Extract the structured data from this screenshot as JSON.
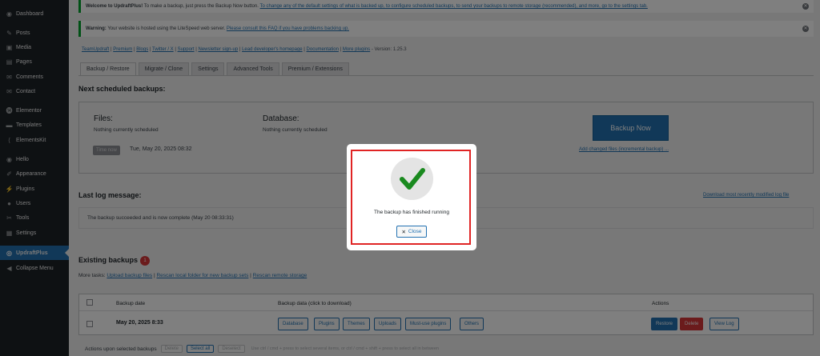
{
  "sidebar": {
    "items": [
      {
        "label": "Dashboard",
        "icon": "dashboard-icon",
        "glyph": "◉"
      },
      {
        "label": "Posts",
        "icon": "pin-icon",
        "glyph": "✎"
      },
      {
        "label": "Media",
        "icon": "media-icon",
        "glyph": "▣"
      },
      {
        "label": "Pages",
        "icon": "page-icon",
        "glyph": "▤"
      },
      {
        "label": "Comments",
        "icon": "comment-icon",
        "glyph": "✉"
      },
      {
        "label": "Contact",
        "icon": "mail-icon",
        "glyph": "✉"
      },
      {
        "label": "Elementor",
        "icon": "elementor-icon",
        "glyph": "⓮"
      },
      {
        "label": "Templates",
        "icon": "folder-icon",
        "glyph": "▬"
      },
      {
        "label": "ElementsKit",
        "icon": "elementskit-icon",
        "glyph": "⟨"
      },
      {
        "label": "Hello",
        "icon": "hello-icon",
        "glyph": "◉"
      },
      {
        "label": "Appearance",
        "icon": "brush-icon",
        "glyph": "✐"
      },
      {
        "label": "Plugins",
        "icon": "plug-icon",
        "glyph": "⚡"
      },
      {
        "label": "Users",
        "icon": "user-icon",
        "glyph": "●"
      },
      {
        "label": "Tools",
        "icon": "wrench-icon",
        "glyph": "✂"
      },
      {
        "label": "Settings",
        "icon": "settings-icon",
        "glyph": "▦"
      },
      {
        "label": "UpdraftPlus",
        "icon": "updraft-icon",
        "glyph": "◎"
      },
      {
        "label": "Collapse Menu",
        "icon": "collapse-icon",
        "glyph": "◀"
      }
    ],
    "active_index": 15
  },
  "notices": {
    "welcome_bold": "Welcome to UpdraftPlus!",
    "welcome_text": " To make a backup, just press the Backup Now button. ",
    "welcome_link": "To change any of the default settings of what is backed up, to configure scheduled backups, to send your backups to remote storage (recommended), and more, go to the settings tab.",
    "warning_bold": "Warning:",
    "warning_text": " Your website is hosted using the LiteSpeed web server. ",
    "warning_link": "Please consult this FAQ if you have problems backing up."
  },
  "top_links": {
    "links": [
      "TeamUpdraft",
      "Premium",
      "Blogs",
      "Twitter / X",
      "Support",
      "Newsletter sign-up",
      "Lead developer's homepage",
      "Documentation",
      "More plugins"
    ],
    "version": " - Version: 1.25.3"
  },
  "tabs": [
    "Backup / Restore",
    "Migrate / Clone",
    "Settings",
    "Advanced Tools",
    "Premium / Extensions"
  ],
  "scheduled": {
    "heading": "Next scheduled backups:",
    "files_title": "Files:",
    "files_status": "Nothing currently scheduled",
    "db_title": "Database:",
    "db_status": "Nothing currently scheduled",
    "time_now_label": "Time now",
    "time_now_value": "Tue, May 20, 2025 08:32",
    "backup_now": "Backup Now",
    "incremental_link": "Add changed files (incremental backup) ..."
  },
  "log": {
    "heading": "Last log message:",
    "download_link": "Download most recently modified log file",
    "message": "The backup succeeded and is now complete (May 20 08:33:31)"
  },
  "existing": {
    "heading": "Existing backups",
    "count": "1",
    "more_tasks_label": "More tasks: ",
    "task_links": [
      "Upload backup files",
      "Rescan local folder for new backup sets",
      "Rescan remote storage"
    ],
    "col_date": "Backup date",
    "col_data": "Backup data (click to download)",
    "col_actions": "Actions",
    "row_date": "May 20, 2025 8:33",
    "data_buttons": [
      "Database",
      "Plugins",
      "Themes",
      "Uploads",
      "Must-use plugins",
      "Others"
    ],
    "restore": "Restore",
    "delete": "Delete",
    "view_log": "View Log",
    "bulk_label": "Actions upon selected backups",
    "bulk_delete": "Delete",
    "bulk_select_all": "Select all",
    "bulk_deselect": "Deselect",
    "bulk_hint": "Use ctrl / cmd + press to select several items, or ctrl / cmd + shift + press to select all in between"
  },
  "modal": {
    "message": "The backup has finished running",
    "close_label": "Close",
    "close_glyph": "✕",
    "check_glyph": "✔"
  },
  "colors": {
    "accent": "#2271b1",
    "success_check": "#1a8a1f",
    "modal_highlight": "#e02424",
    "danger": "#d63638"
  }
}
